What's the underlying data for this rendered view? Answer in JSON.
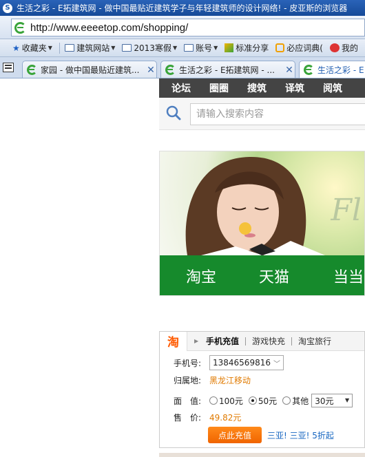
{
  "window": {
    "title": "生活之彩 - E拓建筑网 - 做中国最贴近建筑学子与年轻建筑师的设计网络! - 皮亚斯的浏览器"
  },
  "address": {
    "url": "http://www.eeeetop.com/shopping/"
  },
  "favorites": [
    {
      "label": "收藏夹",
      "icon": "star-icon",
      "dropdown": true
    },
    {
      "label": "建筑网站",
      "icon": "folder-icon",
      "dropdown": true
    },
    {
      "label": "2013寒假",
      "icon": "folder-icon",
      "dropdown": true
    },
    {
      "label": "账号",
      "icon": "folder-icon",
      "dropdown": true
    },
    {
      "label": "标准分享",
      "icon": "site-icon",
      "dropdown": false
    },
    {
      "label": "必应词典(",
      "icon": "bing-icon",
      "dropdown": false
    },
    {
      "label": "我的",
      "icon": "weibo-icon",
      "dropdown": false
    }
  ],
  "tabs": [
    {
      "title": "家园 - 做中国最贴近建筑...",
      "active": false
    },
    {
      "title": "生活之彩 - E拓建筑网 - ...",
      "active": false
    },
    {
      "title": "生活之彩 - E",
      "active": true
    }
  ],
  "site_nav": [
    "论坛",
    "圈圈",
    "搜筑",
    "译筑",
    "阅筑"
  ],
  "search": {
    "placeholder": "请输入搜索内容"
  },
  "banner": {
    "script_text": "Fl",
    "menu": [
      "淘宝",
      "天猫",
      "当当"
    ]
  },
  "recharge": {
    "logo": "淘",
    "tabs": [
      "手机充值",
      "游戏快充",
      "淘宝旅行"
    ],
    "phone_label": "手机号:",
    "phone_value": "13846569816",
    "region_label": "归属地:",
    "region_value": "黑龙江移动",
    "amount_label": "面　值:",
    "amount_options": [
      "100元",
      "50元",
      "其他"
    ],
    "amount_selected": "50元",
    "other_value": "30元",
    "price_label": "售　价:",
    "price_value": "49.82元",
    "submit_label": "点此充值",
    "promo_text": "三亚! 三亚! 5折起"
  },
  "colors": {
    "nav_bg": "#444444",
    "banner_green": "#168a2c",
    "accent_orange": "#f06400",
    "link_blue": "#1565c0"
  }
}
